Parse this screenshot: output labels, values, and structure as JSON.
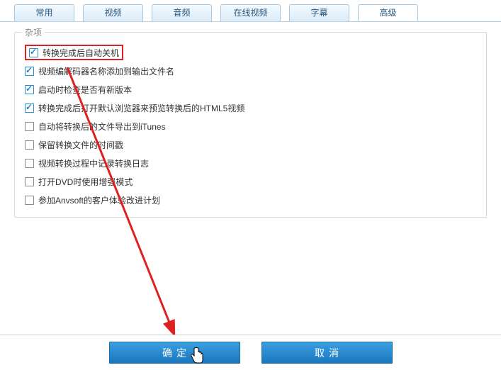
{
  "tabs": [
    {
      "label": "常用",
      "active": false
    },
    {
      "label": "视频",
      "active": false
    },
    {
      "label": "音频",
      "active": false
    },
    {
      "label": "在线视频",
      "active": false
    },
    {
      "label": "字幕",
      "active": false
    },
    {
      "label": "高级",
      "active": true
    }
  ],
  "group": {
    "title": "杂项",
    "options": [
      {
        "label": "转换完成后自动关机",
        "checked": true,
        "highlight": true
      },
      {
        "label": "视频编解码器名称添加到输出文件名",
        "checked": true,
        "highlight": false
      },
      {
        "label": "启动时检查是否有新版本",
        "checked": true,
        "highlight": false
      },
      {
        "label": "转换完成后打开默认浏览器来预览转换后的HTML5视频",
        "checked": true,
        "highlight": false
      },
      {
        "label": "自动将转换后的文件导出到iTunes",
        "checked": false,
        "highlight": false
      },
      {
        "label": "保留转换文件的时间戳",
        "checked": false,
        "highlight": false
      },
      {
        "label": "视频转换过程中记录转换日志",
        "checked": false,
        "highlight": false
      },
      {
        "label": "打开DVD时使用增强模式",
        "checked": false,
        "highlight": false
      },
      {
        "label": "参加Anvsoft的客户体验改进计划",
        "checked": false,
        "highlight": false
      }
    ]
  },
  "buttons": {
    "ok": "确定",
    "cancel": "取消"
  },
  "annotation": {
    "arrow_color": "#e02020"
  }
}
